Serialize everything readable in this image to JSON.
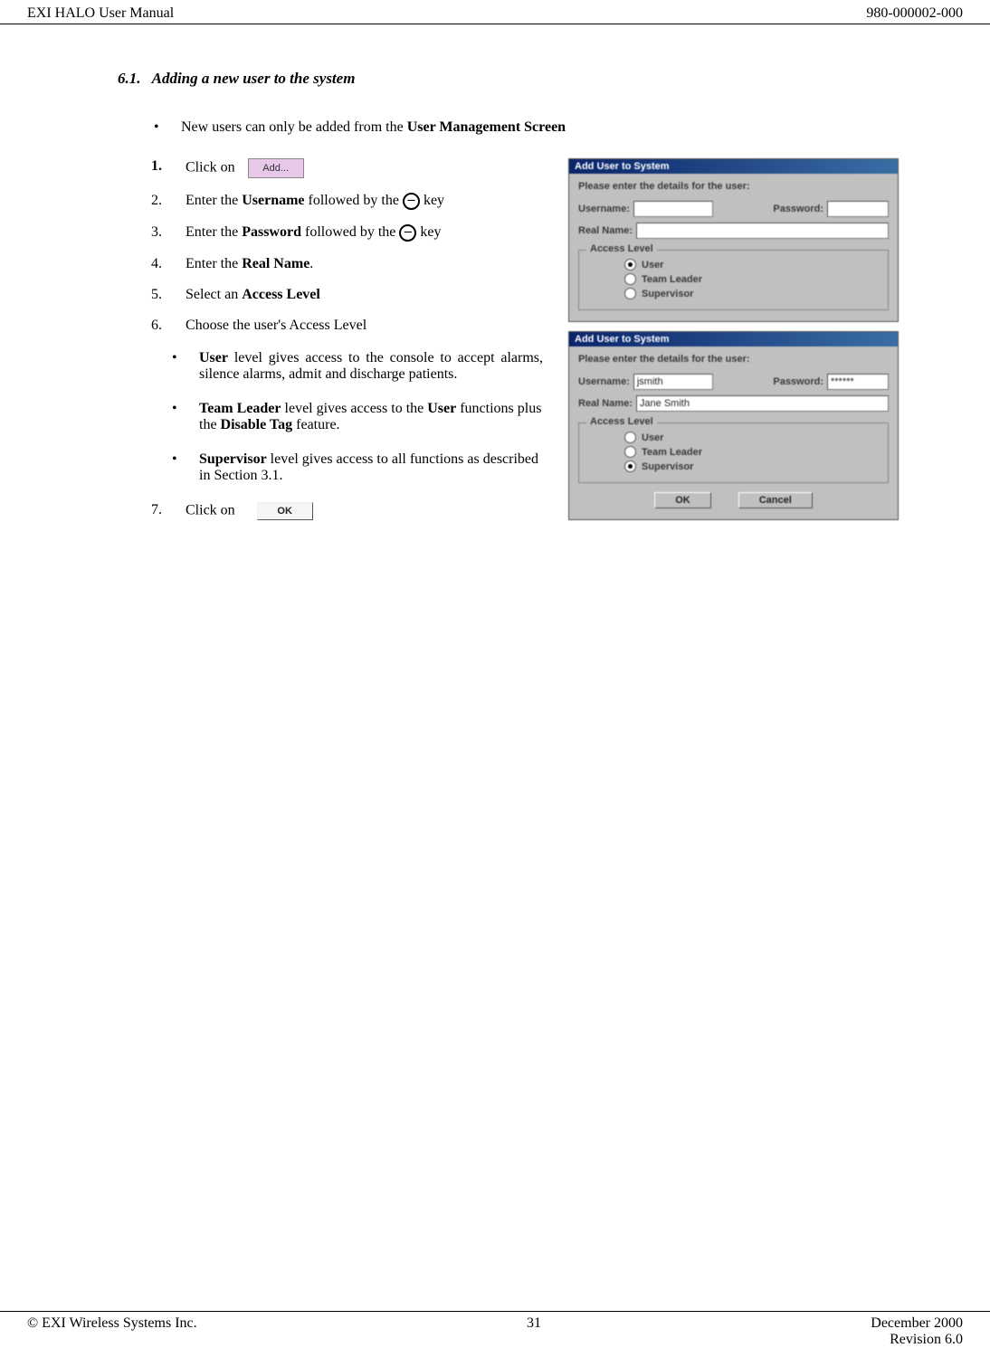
{
  "header": {
    "left": "EXI HALO User Manual",
    "right": "980-000002-000"
  },
  "section": {
    "number": "6.1.",
    "title": "Adding a new user to the system"
  },
  "intro": {
    "text_a": "New users can only be added from the ",
    "text_b": "User Management Screen"
  },
  "steps": {
    "s1": {
      "num": "1.",
      "text": "Click on",
      "button_label": "Add..."
    },
    "s2": {
      "num": "2.",
      "a": "Enter the ",
      "b": "Username",
      "c": " followed by the ",
      "d": " key"
    },
    "s3": {
      "num": "3.",
      "a": "Enter the ",
      "b": "Password",
      "c": " followed by the ",
      "d": " key"
    },
    "s4": {
      "num": "4.",
      "a": "Enter the ",
      "b": "Real Name",
      "c": "."
    },
    "s5": {
      "num": "5.",
      "a": "Select an ",
      "b": "Access Level"
    },
    "s6": {
      "num": "6.",
      "a": "Choose the user's Access Level"
    },
    "sub": {
      "u": {
        "b": "User",
        "rest": " level gives access to the console to accept alarms, silence alarms, admit and discharge patients."
      },
      "t": {
        "b": "Team Leader",
        "c": " level gives access to the ",
        "d": "User",
        "e": " functions plus the ",
        "f": "Disable Tag",
        "g": " feature."
      },
      "s": {
        "b": "Supervisor",
        "rest": " level gives access to all functions as described in Section 3.1."
      }
    },
    "s7": {
      "num": "7.",
      "text": "Click on",
      "button_label": "OK"
    }
  },
  "dialog": {
    "title": "Add User to System",
    "instruction": "Please enter the details for the user:",
    "labels": {
      "username": "Username:",
      "password": "Password:",
      "realname": "Real Name:",
      "access_level": "Access Level"
    },
    "access_options": {
      "user": "User",
      "team_leader": "Team Leader",
      "supervisor": "Supervisor"
    },
    "buttons": {
      "ok": "OK",
      "cancel": "Cancel"
    },
    "dialog1": {
      "username": "",
      "password": "",
      "realname": "",
      "selected": "user"
    },
    "dialog2": {
      "username": "jsmith",
      "password": "******",
      "realname": "Jane Smith",
      "selected": "supervisor"
    }
  },
  "footer": {
    "copyright": "© EXI Wireless Systems Inc.",
    "page": "31",
    "date": "December 2000",
    "revision": "Revision 6.0"
  }
}
